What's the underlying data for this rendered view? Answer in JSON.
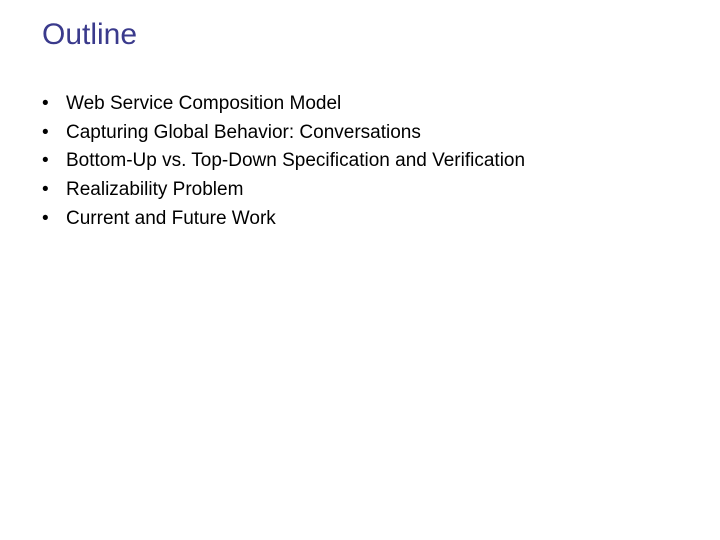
{
  "title": "Outline",
  "bullets": [
    "Web Service Composition Model",
    "Capturing Global Behavior: Conversations",
    "Bottom-Up vs. Top-Down Specification and Verification",
    "Realizability Problem",
    "Current and Future Work"
  ]
}
